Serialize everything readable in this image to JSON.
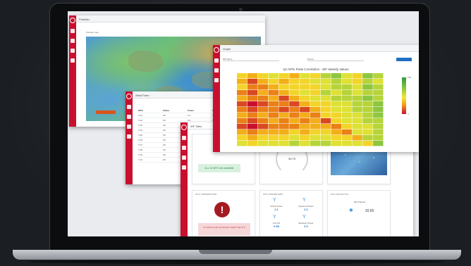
{
  "map_window": {
    "title": "Portfolio",
    "map_label": "Portfolio map"
  },
  "wind_window": {
    "title": "Wind Farm",
    "header": [
      "WTG",
      "Status",
      "Power",
      "Speed"
    ],
    "rows": [
      [
        "T-01",
        "OK",
        "3.2",
        "9.1"
      ],
      [
        "T-02",
        "OK",
        "3.0",
        "8.8"
      ],
      [
        "T-03",
        "OK",
        "3.1",
        "9.0"
      ],
      [
        "T-04",
        "OK",
        "2.9",
        "8.6"
      ],
      [
        "T-05",
        "OK",
        "3.3",
        "9.4"
      ],
      [
        "T-06",
        "OK",
        "3.0",
        "8.9"
      ],
      [
        "T-07",
        "OK",
        "2.8",
        "8.4"
      ],
      [
        "T-08",
        "OK",
        "3.2",
        "9.2"
      ],
      [
        "T-09",
        "OK",
        "3.1",
        "9.0"
      ],
      [
        "T-10",
        "OK",
        "2.9",
        "8.5"
      ]
    ]
  },
  "summary_window": {
    "title": "WF Sites",
    "card_status": "ALL 16 WTG are available",
    "card_gauge_value": "39.79",
    "card_temp_title": "WTG TEMPERATURE",
    "card_temp_alert": "17 turbines with temperature higher than 5°C",
    "card_params_title": "WTG PARAMETERS",
    "card_detection_title": "WTG DETECTION",
    "param_labels": [
      "Active Power",
      "Apparent Power",
      "Cos Phi",
      "Reactive Power"
    ],
    "param_values": [
      "2.1",
      "2.2",
      "0.98",
      "0.3"
    ],
    "wind_speed_label": "Wind Speed",
    "wind_speed_value": "10.65"
  },
  "heat_window": {
    "title": "Graph",
    "filter1": "WF Name",
    "filter2": "Period",
    "title_chart": "QA KPIs Peak Correlation - WF Weekly Values"
  },
  "chart_data": {
    "type": "heatmap",
    "rows": 13,
    "cols": 14,
    "scale_labels": [
      "100",
      "",
      "",
      "",
      "0"
    ],
    "values": [
      [
        0.6,
        0.7,
        0.6,
        0.5,
        0.6,
        0.7,
        0.5,
        0.6,
        0.4,
        0.3,
        0.5,
        0.6,
        0.3,
        0.4
      ],
      [
        0.7,
        0.9,
        0.7,
        0.6,
        0.7,
        0.6,
        0.6,
        0.5,
        0.5,
        0.4,
        0.5,
        0.6,
        0.4,
        0.5
      ],
      [
        0.6,
        0.8,
        0.8,
        0.7,
        0.6,
        0.6,
        0.6,
        0.6,
        0.5,
        0.4,
        0.4,
        0.5,
        0.3,
        0.4
      ],
      [
        0.8,
        0.9,
        0.7,
        0.8,
        0.7,
        0.6,
        0.5,
        0.6,
        0.4,
        0.5,
        0.4,
        0.5,
        0.4,
        0.4
      ],
      [
        0.7,
        0.8,
        0.8,
        0.7,
        0.9,
        0.7,
        0.6,
        0.5,
        0.5,
        0.4,
        0.4,
        0.4,
        0.3,
        0.4
      ],
      [
        0.9,
        1.0,
        0.9,
        0.8,
        0.8,
        0.9,
        0.7,
        0.6,
        0.6,
        0.5,
        0.5,
        0.4,
        0.4,
        0.3
      ],
      [
        0.8,
        0.9,
        0.8,
        0.8,
        0.9,
        0.8,
        0.9,
        0.7,
        0.6,
        0.5,
        0.5,
        0.4,
        0.4,
        0.3
      ],
      [
        0.7,
        0.8,
        0.7,
        0.8,
        0.7,
        0.8,
        0.7,
        0.8,
        0.6,
        0.6,
        0.5,
        0.5,
        0.4,
        0.3
      ],
      [
        0.8,
        0.9,
        0.8,
        0.7,
        0.8,
        0.7,
        0.8,
        0.7,
        0.9,
        0.6,
        0.5,
        0.5,
        0.4,
        0.4
      ],
      [
        0.9,
        1.0,
        0.9,
        0.8,
        0.8,
        0.8,
        0.7,
        0.7,
        0.7,
        0.8,
        0.6,
        0.5,
        0.5,
        0.4
      ],
      [
        0.7,
        0.8,
        0.7,
        0.7,
        0.7,
        0.6,
        0.7,
        0.6,
        0.6,
        0.7,
        0.8,
        0.5,
        0.5,
        0.4
      ],
      [
        0.6,
        0.7,
        0.6,
        0.6,
        0.6,
        0.5,
        0.6,
        0.5,
        0.5,
        0.6,
        0.6,
        0.7,
        0.4,
        0.4
      ],
      [
        0.5,
        0.6,
        0.5,
        0.5,
        0.5,
        0.4,
        0.5,
        0.4,
        0.4,
        0.5,
        0.5,
        0.5,
        0.6,
        0.3
      ]
    ]
  }
}
